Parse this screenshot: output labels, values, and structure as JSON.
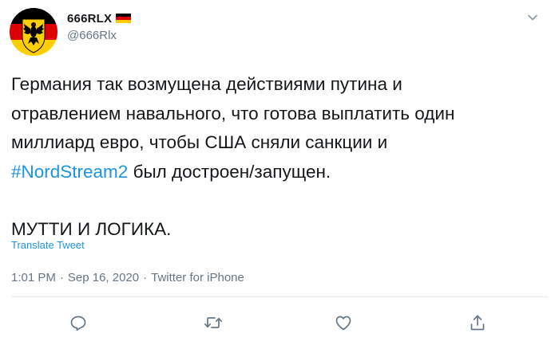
{
  "user": {
    "display_name": "666RLX",
    "handle": "@666Rlx",
    "avatar_icon": "germany-coat-of-arms-icon",
    "flag_icon": "germany-flag-icon"
  },
  "tweet": {
    "line1": "Германия так возмущена действиями путина и",
    "line2": "отравлением навального, что готова выплатить один",
    "line3": "миллиард евро, чтобы США сняли санкции и",
    "hashtag": "#NordStream2",
    "line4_rest": " был достроен/запущен.",
    "line5": "МУТТИ И ЛОГИКА."
  },
  "translate_label": "Translate Tweet",
  "meta": {
    "time": "1:01 PM",
    "date": "Sep 16, 2020",
    "separator": "·",
    "source": "Twitter for iPhone"
  },
  "actions": {
    "reply_icon": "reply-icon",
    "retweet_icon": "retweet-icon",
    "like_icon": "heart-icon",
    "share_icon": "share-icon"
  },
  "colors": {
    "text": "#14171a",
    "secondary": "#657786",
    "link": "#1b95e0",
    "divider": "#e6ecf0"
  }
}
